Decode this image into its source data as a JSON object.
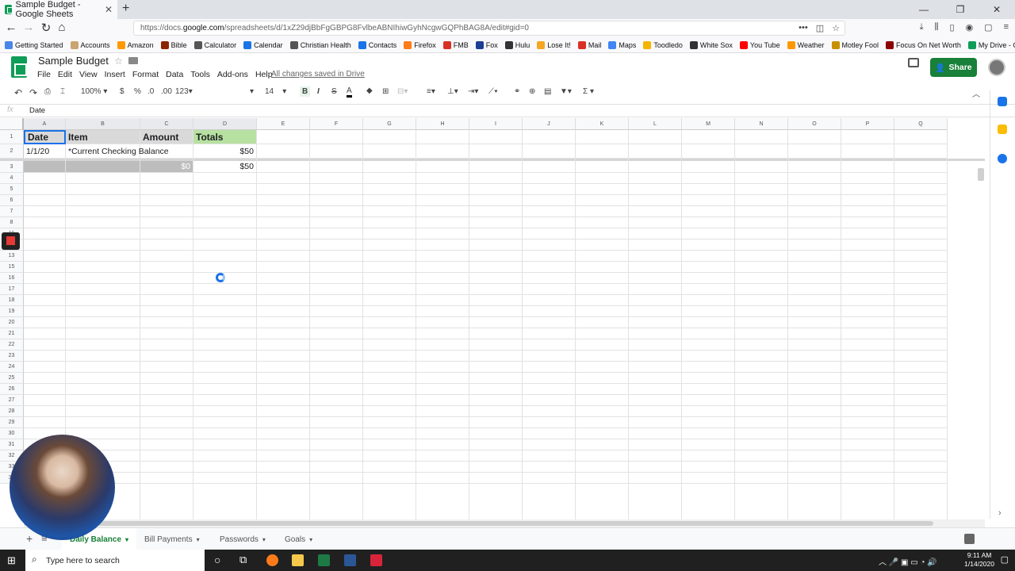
{
  "browser": {
    "tab_title": "Sample Budget - Google Sheets",
    "url_prefix": "https://docs.",
    "url_domain": "google.com",
    "url_rest": "/spreadsheets/d/1xZ29djBbFgGBPG8FvlbeABNIhiwGyhNcgwGQPhBAG8A/edit#gid=0",
    "bookmarks": [
      "Getting Started",
      "Accounts",
      "Amazon",
      "Bible",
      "Calculator",
      "Calendar",
      "Christian Health",
      "Contacts",
      "Firefox",
      "FMB",
      "Fox",
      "Hulu",
      "Lose It!",
      "Mail",
      "Maps",
      "Toodledo",
      "White Sox",
      "You Tube",
      "Weather",
      "Motley Fool",
      "Focus On Net Worth",
      "My Drive - Google Drive"
    ]
  },
  "sheets": {
    "doc_title": "Sample Budget",
    "menus": [
      "File",
      "Edit",
      "View",
      "Insert",
      "Format",
      "Data",
      "Tools",
      "Add-ons",
      "Help"
    ],
    "saved_status": "All changes saved in Drive",
    "share_label": "Share",
    "toolbar": {
      "zoom": "100%",
      "currency": "$",
      "percent": "%",
      "dec_less": ".0",
      "dec_more": ".00",
      "format_more": "123",
      "font_size": "14",
      "bold": "B",
      "italic": "I",
      "strike": "S",
      "text_color": "A",
      "functions": "Σ"
    },
    "formula_value": "Date",
    "columns": [
      "A",
      "B",
      "C",
      "D",
      "E",
      "F",
      "G",
      "H",
      "I",
      "J",
      "K",
      "L",
      "M",
      "N",
      "O",
      "P",
      "Q"
    ],
    "rows": [
      "1",
      "2",
      "3",
      "4",
      "5",
      "6",
      "7",
      "8",
      "11",
      "12",
      "13",
      "15",
      "16",
      "17",
      "18",
      "19",
      "20",
      "21",
      "22",
      "23",
      "24",
      "25",
      "26",
      "27",
      "28",
      "29",
      "30",
      "31",
      "32",
      "33",
      "34"
    ],
    "cells": {
      "a1": "Date",
      "b1": "Item",
      "c1": "Amount",
      "d1": "Totals",
      "a2": "1/1/20",
      "b2": "*Current Checking Balance",
      "d2": "$50",
      "c3": "$0",
      "d3": "$50"
    },
    "sheet_tabs": [
      "Daily Balance",
      "Bill Payments",
      "Passwords",
      "Goals"
    ]
  },
  "taskbar": {
    "search_placeholder": "Type here to search",
    "time": "9:11 AM",
    "date": "1/14/2020"
  }
}
